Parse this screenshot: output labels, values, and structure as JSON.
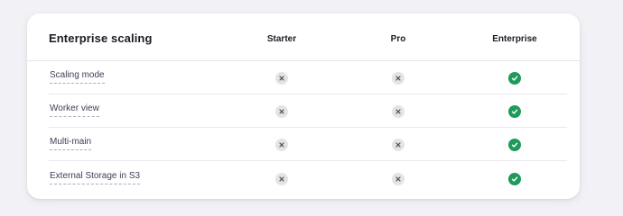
{
  "table": {
    "title": "Enterprise scaling",
    "plans": [
      "Starter",
      "Pro",
      "Enterprise"
    ],
    "rows": [
      {
        "feature": "Scaling mode",
        "starter": "x-icon",
        "pro": "x-icon",
        "enterprise": "check-icon"
      },
      {
        "feature": "Worker view",
        "starter": "x-icon",
        "pro": "x-icon",
        "enterprise": "check-icon"
      },
      {
        "feature": "Multi-main",
        "starter": "x-icon",
        "pro": "x-icon",
        "enterprise": "check-icon"
      },
      {
        "feature": "External Storage in S3",
        "starter": "x-icon",
        "pro": "x-icon",
        "enterprise": "check-icon"
      }
    ]
  },
  "colors": {
    "included": "#1f9a5a",
    "not_included": "#e4e4e6"
  }
}
